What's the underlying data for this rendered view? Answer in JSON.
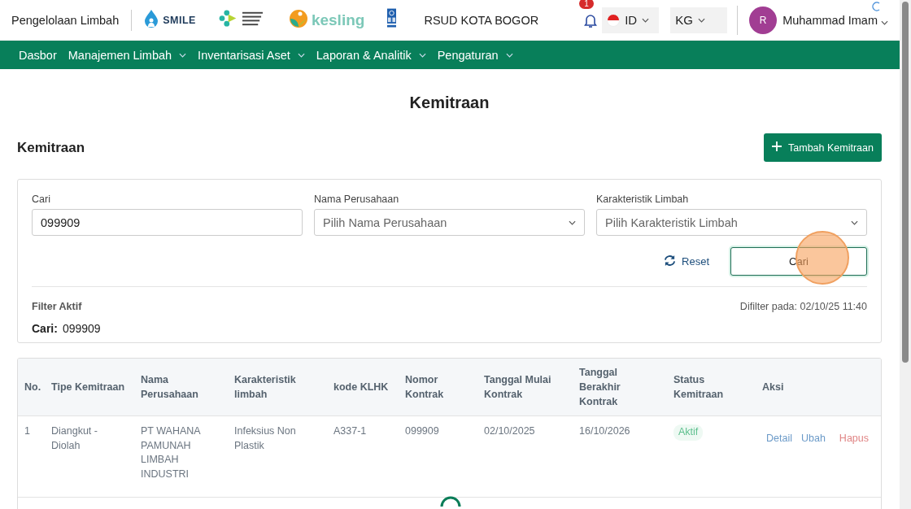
{
  "header": {
    "app_title": "Pengelolaan Limbah",
    "logos": [
      {
        "kind": "smile",
        "text": "SMILE"
      },
      {
        "kind": "kemenkes"
      },
      {
        "kind": "kesling",
        "text": "kesling"
      },
      {
        "kind": "undp"
      }
    ],
    "hospital": "RSUD KOTA BOGOR",
    "notification_count": "1",
    "language": "ID",
    "unit": "KG",
    "user": {
      "initial": "R",
      "name": "Muhammad Imam"
    }
  },
  "nav": [
    {
      "label": "Dasbor",
      "dropdown": false
    },
    {
      "label": "Manajemen Limbah",
      "dropdown": true
    },
    {
      "label": "Inventarisasi Aset",
      "dropdown": true
    },
    {
      "label": "Laporan & Analitik",
      "dropdown": true
    },
    {
      "label": "Pengaturan",
      "dropdown": true
    }
  ],
  "page_title": "Kemitraan",
  "section_title": "Kemitraan",
  "add_button": "Tambah Kemitraan",
  "filters": [
    {
      "kind": "text",
      "label": "Cari",
      "value": "099909"
    },
    {
      "kind": "select",
      "label": "Nama Perusahaan",
      "placeholder": "Pilih Nama Perusahaan"
    },
    {
      "kind": "select",
      "label": "Karakteristik Limbah",
      "placeholder": "Pilih Karakteristik Limbah"
    }
  ],
  "reset_button": "Reset",
  "search_button": "Cari",
  "active_filters": {
    "title": "Filter Aktif",
    "filtered_at": "Difilter pada: 02/10/25 11:40",
    "items": [
      {
        "label": "Cari:",
        "value": "099909"
      }
    ]
  },
  "table": {
    "columns": [
      "No.",
      "Tipe Kemitraan",
      "Nama Perusahaan",
      "Karakteristik limbah",
      "kode KLHK",
      "Nomor Kontrak",
      "Tanggal Mulai Kontrak",
      "Tanggal Berakhir Kontrak",
      "Status Kemitraan",
      "Aksi"
    ],
    "rows": [
      {
        "cells": [
          "1",
          "Diangkut - Diolah",
          "PT WAHANA PAMUNAH LIMBAH INDUSTRI",
          "Infeksius Non Plastik",
          "A337-1",
          "099909",
          "02/10/2025",
          "16/10/2026"
        ],
        "status": "Aktif",
        "actions": [
          {
            "label": "Detail",
            "kind": "detail"
          },
          {
            "label": "Ubah",
            "kind": "edit"
          },
          {
            "label": "Hapus",
            "kind": "delete"
          }
        ]
      }
    ]
  }
}
